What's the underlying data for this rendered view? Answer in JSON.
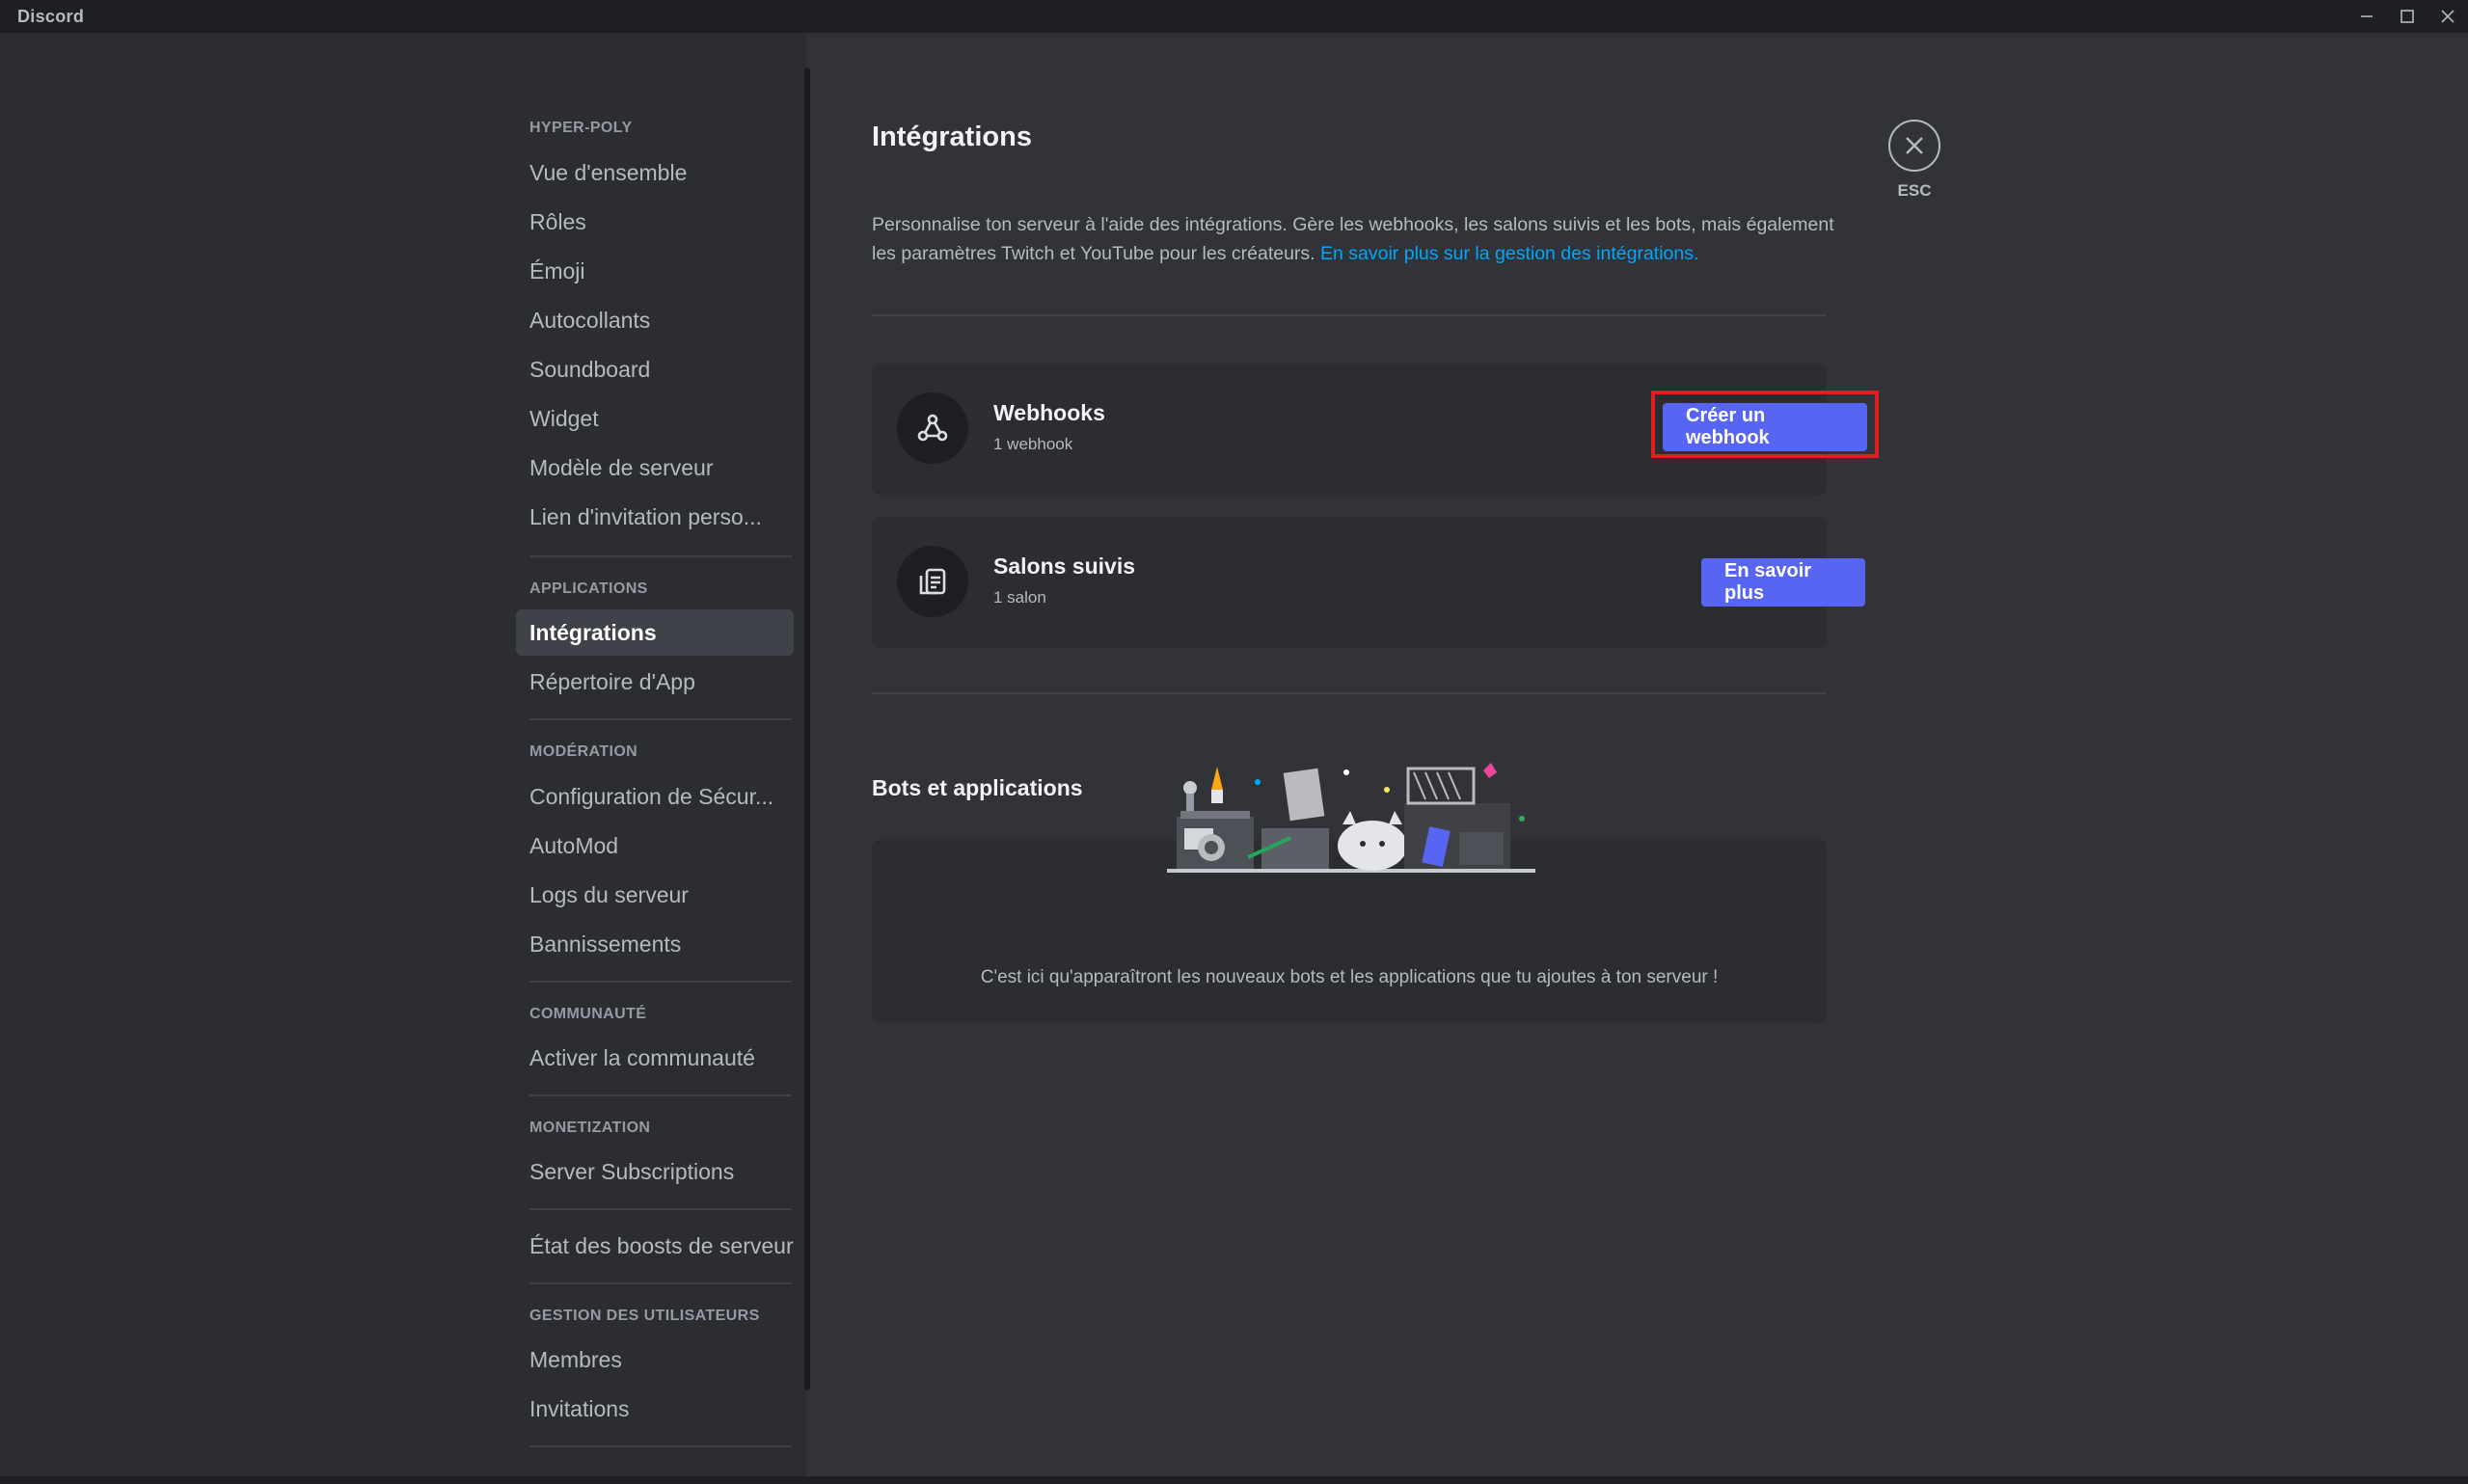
{
  "app": {
    "title": "Discord"
  },
  "sidebar": {
    "sections": [
      {
        "header": "HYPER-POLY",
        "items": [
          "Vue d'ensemble",
          "Rôles",
          "Émoji",
          "Autocollants",
          "Soundboard",
          "Widget",
          "Modèle de serveur",
          "Lien d'invitation perso..."
        ]
      },
      {
        "header": "APPLICATIONS",
        "items": [
          "Intégrations",
          "Répertoire d'App"
        ]
      },
      {
        "header": "MODÉRATION",
        "items": [
          "Configuration de Sécur...",
          "AutoMod",
          "Logs du serveur",
          "Bannissements"
        ]
      },
      {
        "header": "COMMUNAUTÉ",
        "items": [
          "Activer la communauté"
        ]
      },
      {
        "header": "MONETIZATION",
        "items": [
          "Server Subscriptions"
        ]
      },
      {
        "header": "",
        "items": [
          "État des boosts de serveur"
        ]
      },
      {
        "header": "GESTION DES UTILISATEURS",
        "items": [
          "Membres",
          "Invitations"
        ]
      }
    ],
    "active_item": "Intégrations"
  },
  "main": {
    "title": "Intégrations",
    "description": "Personnalise ton serveur à l'aide des intégrations. Gère les webhooks, les salons suivis et les bots, mais également les paramètres Twitch et YouTube pour les créateurs.",
    "description_link": "En savoir plus sur la gestion des intégrations.",
    "webhooks": {
      "title": "Webhooks",
      "subtitle": "1 webhook",
      "button": "Créer un webhook"
    },
    "followed": {
      "title": "Salons suivis",
      "subtitle": "1 salon",
      "button": "En savoir plus"
    },
    "bots": {
      "title": "Bots et applications",
      "empty_text": "C'est ici qu'apparaîtront les nouveaux bots et les applications que tu ajoutes à ton serveur !"
    },
    "close": {
      "label": "ESC"
    }
  },
  "colors": {
    "accent": "#5865f2",
    "link": "#00a8fc",
    "highlight": "#e01e1e"
  }
}
